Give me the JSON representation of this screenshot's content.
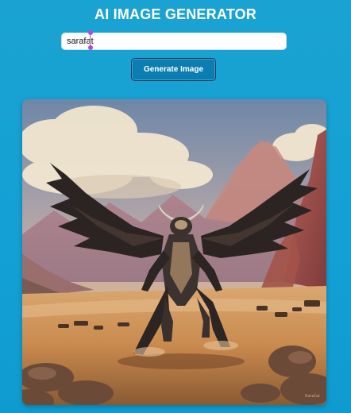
{
  "app": {
    "title": "AI IMAGE GENERATOR"
  },
  "prompt": {
    "value": "sarafat",
    "placeholder": ""
  },
  "actions": {
    "generate_label": "Generate Image"
  },
  "result": {
    "image_alt_name": "generated-image",
    "signature": "Sarafat"
  },
  "colors": {
    "background": "#13a0d4",
    "button": "#0c7db0",
    "button_border": "#0b3a58",
    "caret": "#b348d6"
  }
}
